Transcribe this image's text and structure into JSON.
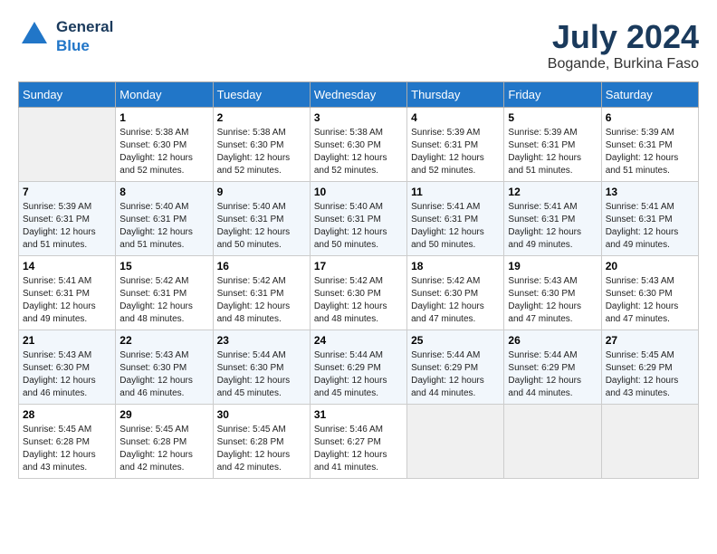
{
  "header": {
    "logo_line1": "General",
    "logo_line2": "Blue",
    "month_title": "July 2024",
    "location": "Bogande, Burkina Faso"
  },
  "days_of_week": [
    "Sunday",
    "Monday",
    "Tuesday",
    "Wednesday",
    "Thursday",
    "Friday",
    "Saturday"
  ],
  "weeks": [
    [
      {
        "day": "",
        "sunrise": "",
        "sunset": "",
        "daylight": ""
      },
      {
        "day": "1",
        "sunrise": "Sunrise: 5:38 AM",
        "sunset": "Sunset: 6:30 PM",
        "daylight": "Daylight: 12 hours and 52 minutes."
      },
      {
        "day": "2",
        "sunrise": "Sunrise: 5:38 AM",
        "sunset": "Sunset: 6:30 PM",
        "daylight": "Daylight: 12 hours and 52 minutes."
      },
      {
        "day": "3",
        "sunrise": "Sunrise: 5:38 AM",
        "sunset": "Sunset: 6:30 PM",
        "daylight": "Daylight: 12 hours and 52 minutes."
      },
      {
        "day": "4",
        "sunrise": "Sunrise: 5:39 AM",
        "sunset": "Sunset: 6:31 PM",
        "daylight": "Daylight: 12 hours and 52 minutes."
      },
      {
        "day": "5",
        "sunrise": "Sunrise: 5:39 AM",
        "sunset": "Sunset: 6:31 PM",
        "daylight": "Daylight: 12 hours and 51 minutes."
      },
      {
        "day": "6",
        "sunrise": "Sunrise: 5:39 AM",
        "sunset": "Sunset: 6:31 PM",
        "daylight": "Daylight: 12 hours and 51 minutes."
      }
    ],
    [
      {
        "day": "7",
        "sunrise": "Sunrise: 5:39 AM",
        "sunset": "Sunset: 6:31 PM",
        "daylight": "Daylight: 12 hours and 51 minutes."
      },
      {
        "day": "8",
        "sunrise": "Sunrise: 5:40 AM",
        "sunset": "Sunset: 6:31 PM",
        "daylight": "Daylight: 12 hours and 51 minutes."
      },
      {
        "day": "9",
        "sunrise": "Sunrise: 5:40 AM",
        "sunset": "Sunset: 6:31 PM",
        "daylight": "Daylight: 12 hours and 50 minutes."
      },
      {
        "day": "10",
        "sunrise": "Sunrise: 5:40 AM",
        "sunset": "Sunset: 6:31 PM",
        "daylight": "Daylight: 12 hours and 50 minutes."
      },
      {
        "day": "11",
        "sunrise": "Sunrise: 5:41 AM",
        "sunset": "Sunset: 6:31 PM",
        "daylight": "Daylight: 12 hours and 50 minutes."
      },
      {
        "day": "12",
        "sunrise": "Sunrise: 5:41 AM",
        "sunset": "Sunset: 6:31 PM",
        "daylight": "Daylight: 12 hours and 49 minutes."
      },
      {
        "day": "13",
        "sunrise": "Sunrise: 5:41 AM",
        "sunset": "Sunset: 6:31 PM",
        "daylight": "Daylight: 12 hours and 49 minutes."
      }
    ],
    [
      {
        "day": "14",
        "sunrise": "Sunrise: 5:41 AM",
        "sunset": "Sunset: 6:31 PM",
        "daylight": "Daylight: 12 hours and 49 minutes."
      },
      {
        "day": "15",
        "sunrise": "Sunrise: 5:42 AM",
        "sunset": "Sunset: 6:31 PM",
        "daylight": "Daylight: 12 hours and 48 minutes."
      },
      {
        "day": "16",
        "sunrise": "Sunrise: 5:42 AM",
        "sunset": "Sunset: 6:31 PM",
        "daylight": "Daylight: 12 hours and 48 minutes."
      },
      {
        "day": "17",
        "sunrise": "Sunrise: 5:42 AM",
        "sunset": "Sunset: 6:30 PM",
        "daylight": "Daylight: 12 hours and 48 minutes."
      },
      {
        "day": "18",
        "sunrise": "Sunrise: 5:42 AM",
        "sunset": "Sunset: 6:30 PM",
        "daylight": "Daylight: 12 hours and 47 minutes."
      },
      {
        "day": "19",
        "sunrise": "Sunrise: 5:43 AM",
        "sunset": "Sunset: 6:30 PM",
        "daylight": "Daylight: 12 hours and 47 minutes."
      },
      {
        "day": "20",
        "sunrise": "Sunrise: 5:43 AM",
        "sunset": "Sunset: 6:30 PM",
        "daylight": "Daylight: 12 hours and 47 minutes."
      }
    ],
    [
      {
        "day": "21",
        "sunrise": "Sunrise: 5:43 AM",
        "sunset": "Sunset: 6:30 PM",
        "daylight": "Daylight: 12 hours and 46 minutes."
      },
      {
        "day": "22",
        "sunrise": "Sunrise: 5:43 AM",
        "sunset": "Sunset: 6:30 PM",
        "daylight": "Daylight: 12 hours and 46 minutes."
      },
      {
        "day": "23",
        "sunrise": "Sunrise: 5:44 AM",
        "sunset": "Sunset: 6:30 PM",
        "daylight": "Daylight: 12 hours and 45 minutes."
      },
      {
        "day": "24",
        "sunrise": "Sunrise: 5:44 AM",
        "sunset": "Sunset: 6:29 PM",
        "daylight": "Daylight: 12 hours and 45 minutes."
      },
      {
        "day": "25",
        "sunrise": "Sunrise: 5:44 AM",
        "sunset": "Sunset: 6:29 PM",
        "daylight": "Daylight: 12 hours and 44 minutes."
      },
      {
        "day": "26",
        "sunrise": "Sunrise: 5:44 AM",
        "sunset": "Sunset: 6:29 PM",
        "daylight": "Daylight: 12 hours and 44 minutes."
      },
      {
        "day": "27",
        "sunrise": "Sunrise: 5:45 AM",
        "sunset": "Sunset: 6:29 PM",
        "daylight": "Daylight: 12 hours and 43 minutes."
      }
    ],
    [
      {
        "day": "28",
        "sunrise": "Sunrise: 5:45 AM",
        "sunset": "Sunset: 6:28 PM",
        "daylight": "Daylight: 12 hours and 43 minutes."
      },
      {
        "day": "29",
        "sunrise": "Sunrise: 5:45 AM",
        "sunset": "Sunset: 6:28 PM",
        "daylight": "Daylight: 12 hours and 42 minutes."
      },
      {
        "day": "30",
        "sunrise": "Sunrise: 5:45 AM",
        "sunset": "Sunset: 6:28 PM",
        "daylight": "Daylight: 12 hours and 42 minutes."
      },
      {
        "day": "31",
        "sunrise": "Sunrise: 5:46 AM",
        "sunset": "Sunset: 6:27 PM",
        "daylight": "Daylight: 12 hours and 41 minutes."
      },
      {
        "day": "",
        "sunrise": "",
        "sunset": "",
        "daylight": ""
      },
      {
        "day": "",
        "sunrise": "",
        "sunset": "",
        "daylight": ""
      },
      {
        "day": "",
        "sunrise": "",
        "sunset": "",
        "daylight": ""
      }
    ]
  ]
}
